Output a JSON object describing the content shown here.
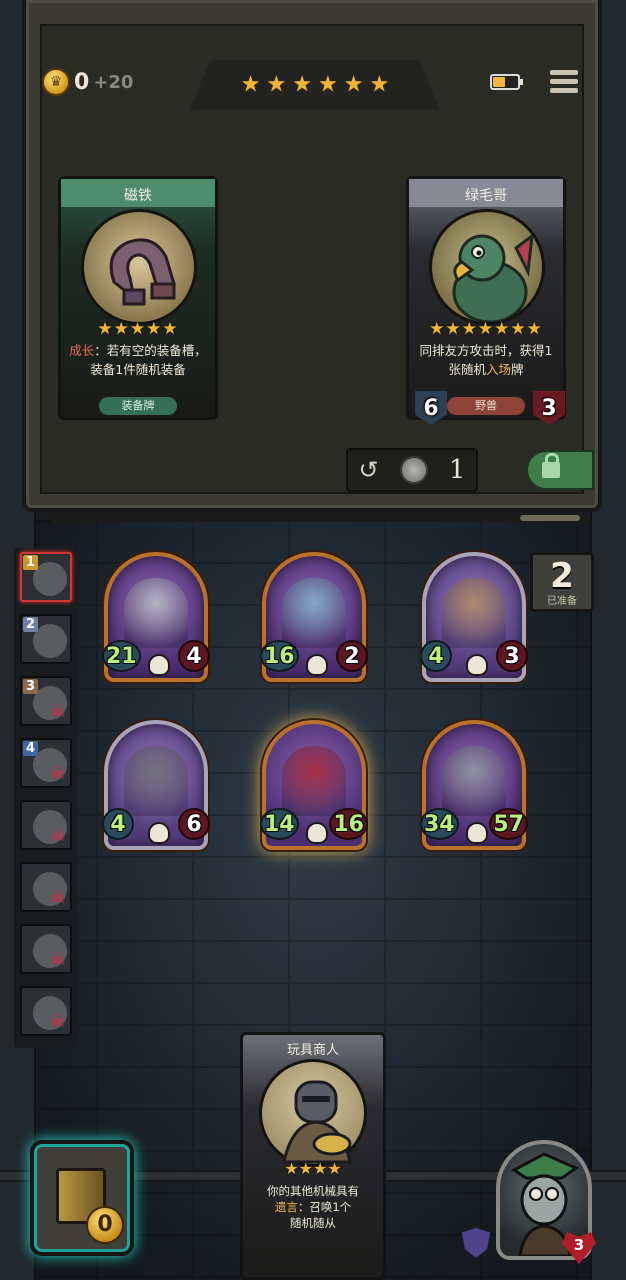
{
  "top_bar": {
    "gold": "0",
    "gold_income": "+20",
    "tavern_stars": 6,
    "battery_level": 0.5
  },
  "shop": {
    "cards": [
      {
        "name": "磁铁",
        "stars": 5,
        "keyword": "成长",
        "desc_rest": "：若有空的装备槽，装备1件随机装备",
        "tag": "装备牌",
        "frame": "green"
      },
      {
        "name": "绿毛哥",
        "stars": 7,
        "desc_a": "同排友方攻击时，获得1张随机",
        "keyword": "入场",
        "desc_b": "牌",
        "tag": "野兽",
        "attack": "6",
        "health": "3",
        "frame": "gray"
      }
    ],
    "refresh_cost": "1"
  },
  "ready_counter": {
    "count": "2",
    "label": "已准备"
  },
  "opponents": [
    {
      "rank": "1",
      "active": true,
      "defeated": false,
      "rank_color": "#c99a2a"
    },
    {
      "rank": "2",
      "active": false,
      "defeated": false,
      "rank_color": "#6e7fa8"
    },
    {
      "rank": "3",
      "active": false,
      "defeated": true,
      "rank_color": "#8a6a4a"
    },
    {
      "rank": "4",
      "active": false,
      "defeated": true,
      "rank_color": "#3f64a8"
    },
    {
      "rank": "",
      "active": false,
      "defeated": true,
      "rank_color": ""
    },
    {
      "rank": "",
      "active": false,
      "defeated": true,
      "rank_color": ""
    },
    {
      "rank": "",
      "active": false,
      "defeated": true,
      "rank_color": ""
    },
    {
      "rank": "",
      "active": false,
      "defeated": true,
      "rank_color": ""
    }
  ],
  "board": {
    "front_row": [
      {
        "name": "robot",
        "attack": "21",
        "health": "4",
        "frame": "gold"
      },
      {
        "name": "rabbit",
        "attack": "16",
        "health": "2",
        "frame": "gold"
      },
      {
        "name": "rocket",
        "attack": "4",
        "health": "3",
        "frame": "silver"
      }
    ],
    "back_row": [
      {
        "name": "knight",
        "attack": "4",
        "health": "6",
        "frame": "silver"
      },
      {
        "name": "clown",
        "attack": "14",
        "health": "16",
        "frame": "gold"
      },
      {
        "name": "cannon",
        "attack": "34",
        "health": "57",
        "frame": "gold"
      }
    ]
  },
  "hand": {
    "name": "玩具商人",
    "stars": 4,
    "desc_a": "你的其他机械具有",
    "keyword": "遗言",
    "desc_b": "：召唤1个",
    "desc_c": "随机随从"
  },
  "sell_value": "0",
  "hero": {
    "health": "3"
  },
  "colors": {
    "gold": "#f2b636",
    "danger": "#e6224a",
    "ready_bg": "#3f403b"
  }
}
